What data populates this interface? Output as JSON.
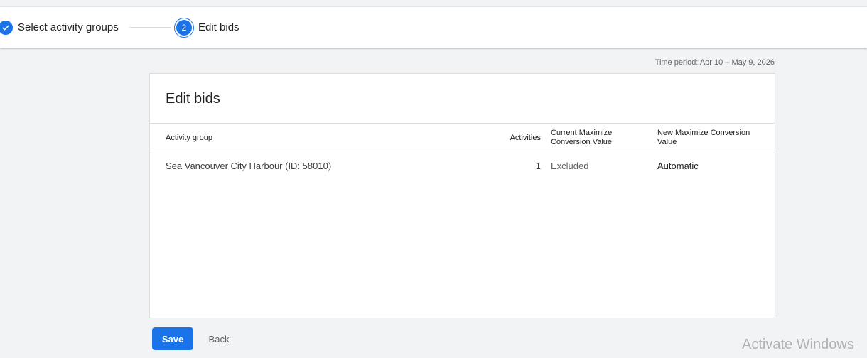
{
  "stepper": {
    "steps": [
      {
        "label": "Select activity groups",
        "status": "done"
      },
      {
        "number": "2",
        "label": "Edit bids",
        "status": "active"
      }
    ]
  },
  "time_period": "Time period: Apr 10 – May 9, 2026",
  "card": {
    "title": "Edit bids",
    "columns": {
      "group": "Activity group",
      "activities": "Activities",
      "current": "Current Maximize Conversion Value",
      "new": "New Maximize Conversion Value"
    },
    "rows": [
      {
        "group": "Sea Vancouver City Harbour (ID: 58010)",
        "activities": "1",
        "current": "Excluded",
        "new": "Automatic"
      }
    ]
  },
  "actions": {
    "save_label": "Save",
    "back_label": "Back"
  },
  "watermark": {
    "title": "Activate Windows"
  },
  "colors": {
    "accent": "#1a73e8",
    "background": "#f1f3f4"
  }
}
